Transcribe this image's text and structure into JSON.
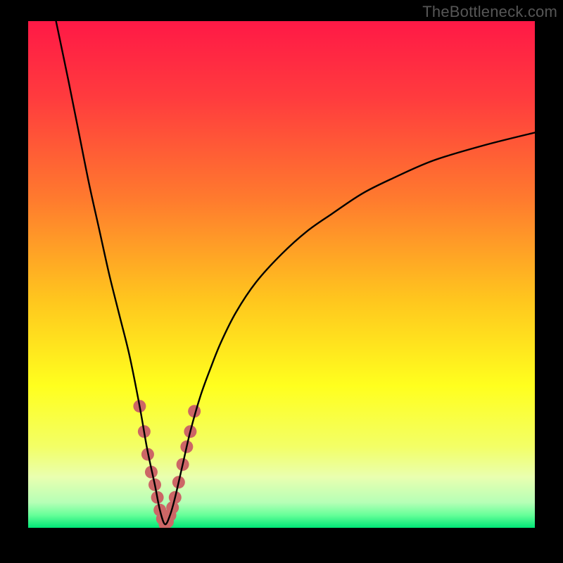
{
  "watermark": {
    "text": "TheBottleneck.com"
  },
  "colors": {
    "black": "#000000",
    "curve": "#000000",
    "marker": "#cc6666",
    "gradient_stops": [
      {
        "offset": 0.0,
        "color": "#ff1946"
      },
      {
        "offset": 0.15,
        "color": "#ff3b3e"
      },
      {
        "offset": 0.35,
        "color": "#ff7a2e"
      },
      {
        "offset": 0.55,
        "color": "#ffc61e"
      },
      {
        "offset": 0.72,
        "color": "#ffff1e"
      },
      {
        "offset": 0.84,
        "color": "#f3ff66"
      },
      {
        "offset": 0.9,
        "color": "#e9ffb0"
      },
      {
        "offset": 0.95,
        "color": "#b6ffb6"
      },
      {
        "offset": 0.975,
        "color": "#66ff99"
      },
      {
        "offset": 1.0,
        "color": "#00e676"
      }
    ]
  },
  "chart_data": {
    "type": "line",
    "title": "",
    "xlabel": "",
    "ylabel": "",
    "xlim": [
      0,
      100
    ],
    "ylim": [
      0,
      100
    ],
    "x_min_at": 27,
    "left_start": {
      "x": 5.5,
      "y": 100
    },
    "right_end": {
      "x": 100,
      "y": 78
    },
    "min_y": 0,
    "marker_region": {
      "x_start": 22,
      "x_end": 32,
      "y_max": 14
    },
    "series": [
      {
        "name": "bottleneck-curve",
        "x": [
          5.5,
          8,
          10,
          12,
          14,
          16,
          18,
          20,
          22,
          23.5,
          25,
          26,
          27,
          28,
          29,
          30.5,
          32,
          34,
          36,
          38,
          41,
          45,
          50,
          55,
          60,
          66,
          72,
          80,
          90,
          100
        ],
        "y": [
          100,
          88,
          78,
          68,
          59,
          50,
          42,
          34,
          24,
          15.5,
          8.5,
          3.5,
          0.7,
          2.5,
          6.0,
          12.5,
          19,
          26,
          31.5,
          36.5,
          42.5,
          48.5,
          54,
          58.5,
          62,
          66,
          69,
          72.5,
          75.5,
          78
        ]
      }
    ],
    "markers": {
      "name": "min-region-dots",
      "points": [
        {
          "x": 22.0,
          "y": 24.0
        },
        {
          "x": 22.9,
          "y": 19.0
        },
        {
          "x": 23.6,
          "y": 14.5
        },
        {
          "x": 24.3,
          "y": 11.0
        },
        {
          "x": 25.0,
          "y": 8.5
        },
        {
          "x": 25.5,
          "y": 6.0
        },
        {
          "x": 26.0,
          "y": 3.5
        },
        {
          "x": 26.5,
          "y": 1.8
        },
        {
          "x": 27.0,
          "y": 0.7
        },
        {
          "x": 27.5,
          "y": 1.2
        },
        {
          "x": 28.0,
          "y": 2.5
        },
        {
          "x": 28.5,
          "y": 4.0
        },
        {
          "x": 29.0,
          "y": 6.0
        },
        {
          "x": 29.7,
          "y": 9.0
        },
        {
          "x": 30.5,
          "y": 12.5
        },
        {
          "x": 31.3,
          "y": 16.0
        },
        {
          "x": 32.0,
          "y": 19.0
        },
        {
          "x": 32.8,
          "y": 23.0
        }
      ]
    }
  }
}
